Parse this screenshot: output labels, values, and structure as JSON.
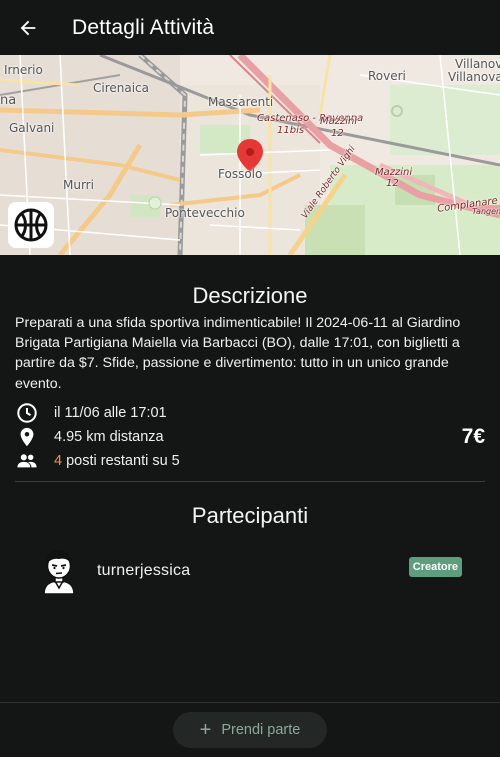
{
  "appbar": {
    "title": "Dettagli Attività",
    "back_icon": "arrow-back-icon"
  },
  "map": {
    "labels": {
      "irnerio": "Irnerio",
      "cirenaica": "Cirenaica",
      "massarenti": "Massarenti",
      "roveri": "Roveri",
      "villanova": "Villanova",
      "villanova_stat": "Villanova Stat",
      "na": "na",
      "galvani": "Galvani",
      "murri": "Murri",
      "fossolo": "Fossolo",
      "pontevecchio": "Pontevecchio",
      "castenaso1": "Castenaso - Ravenna",
      "castenaso2": "11bis",
      "mazzini1": "Mazzini",
      "mazzini1b": "12",
      "mazzini2": "Mazzini",
      "mazzini2b": "12",
      "viale": "Viale Roberto Vighi",
      "complanare": "Complanare S",
      "tangenziale": "Tangenziale"
    },
    "pin_color": "#e53935",
    "sport_icon": "basketball-icon"
  },
  "description": {
    "title": "Descrizione",
    "text": "Preparati a una sfida sportiva indimenticabile! Il 2024-06-11 al Giardino Brigata Partigiana Maiella via Barbacci (BO), dalle 17:01, con biglietti a partire da $7. Sfide, passione e divertimento: tutto in un unico grande evento."
  },
  "info": {
    "datetime": "il 11/06 alle 17:01",
    "distance": "4.95 km distanza",
    "spots_count": "4",
    "spots_text": " posti restanti su 5",
    "price": "7€"
  },
  "participants": {
    "title": "Partecipanti",
    "items": [
      {
        "name": "turnerjessica",
        "badge": "Creatore"
      }
    ]
  },
  "footer": {
    "join_label": "Prendi parte"
  },
  "colors": {
    "accent_orange": "#f0923a",
    "badge_green": "#5e9d7d",
    "background": "#141515"
  }
}
